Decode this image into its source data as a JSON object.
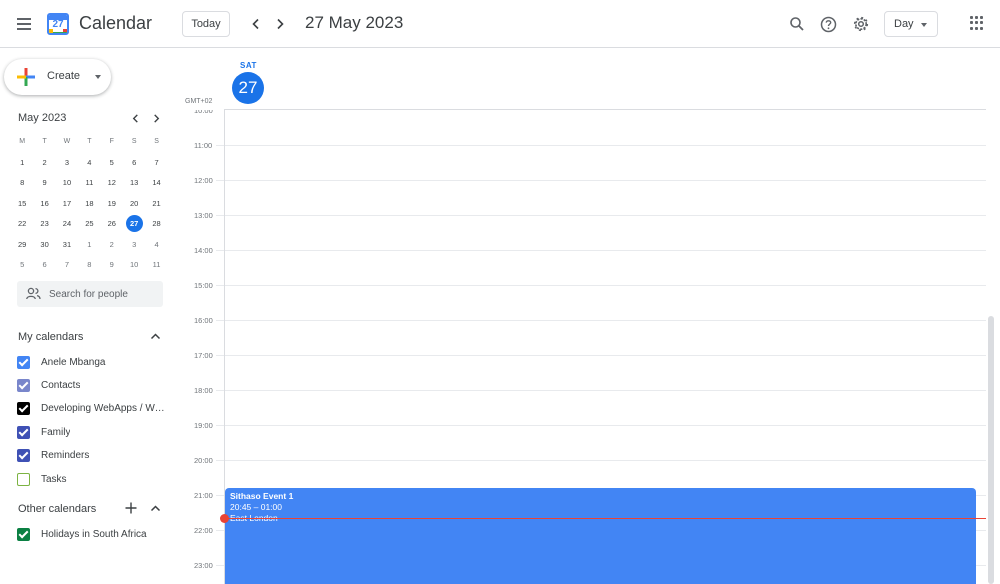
{
  "header": {
    "app_title": "Calendar",
    "logo_day": "27",
    "today_label": "Today",
    "current_date": "27 May 2023",
    "view_label": "Day"
  },
  "sidebar": {
    "create_label": "Create",
    "mini_calendar": {
      "title": "May 2023",
      "weekdays": [
        "M",
        "T",
        "W",
        "T",
        "F",
        "S",
        "S"
      ],
      "weeks": [
        [
          "1",
          "2",
          "3",
          "4",
          "5",
          "6",
          "7"
        ],
        [
          "8",
          "9",
          "10",
          "11",
          "12",
          "13",
          "14"
        ],
        [
          "15",
          "16",
          "17",
          "18",
          "19",
          "20",
          "21"
        ],
        [
          "22",
          "23",
          "24",
          "25",
          "26",
          "27",
          "28"
        ],
        [
          "29",
          "30",
          "31",
          "1",
          "2",
          "3",
          "4"
        ],
        [
          "5",
          "6",
          "7",
          "8",
          "9",
          "10",
          "11"
        ]
      ],
      "selected_day": "27"
    },
    "people_search_placeholder": "Search for people",
    "my_calendars": {
      "title": "My calendars",
      "items": [
        {
          "label": "Anele Mbanga",
          "color": "#4285f4",
          "checked": true
        },
        {
          "label": "Contacts",
          "color": "#7986cb",
          "checked": true
        },
        {
          "label": "Developing WebApps / Web Development",
          "color": "#000000",
          "checked": true
        },
        {
          "label": "Family",
          "color": "#3f51b5",
          "checked": true
        },
        {
          "label": "Reminders",
          "color": "#3f51b5",
          "checked": true
        },
        {
          "label": "Tasks",
          "color": "#7cb342",
          "checked": false
        }
      ]
    },
    "other_calendars": {
      "title": "Other calendars",
      "items": [
        {
          "label": "Holidays in South Africa",
          "color": "#0b8043",
          "checked": true
        }
      ]
    }
  },
  "day_view": {
    "day_abbr": "SAT",
    "day_number": "27",
    "timezone": "GMT+02",
    "hours": [
      "10:00",
      "11:00",
      "12:00",
      "13:00",
      "14:00",
      "15:00",
      "16:00",
      "17:00",
      "18:00",
      "19:00",
      "20:00",
      "21:00",
      "22:00",
      "23:00"
    ],
    "event": {
      "title": "Sithaso Event 1",
      "time": "20:45 – 01:00",
      "location": "East London",
      "color": "#4285f4"
    }
  },
  "colors": {
    "accent": "#1a73e8",
    "now_indicator": "#ea4335"
  }
}
